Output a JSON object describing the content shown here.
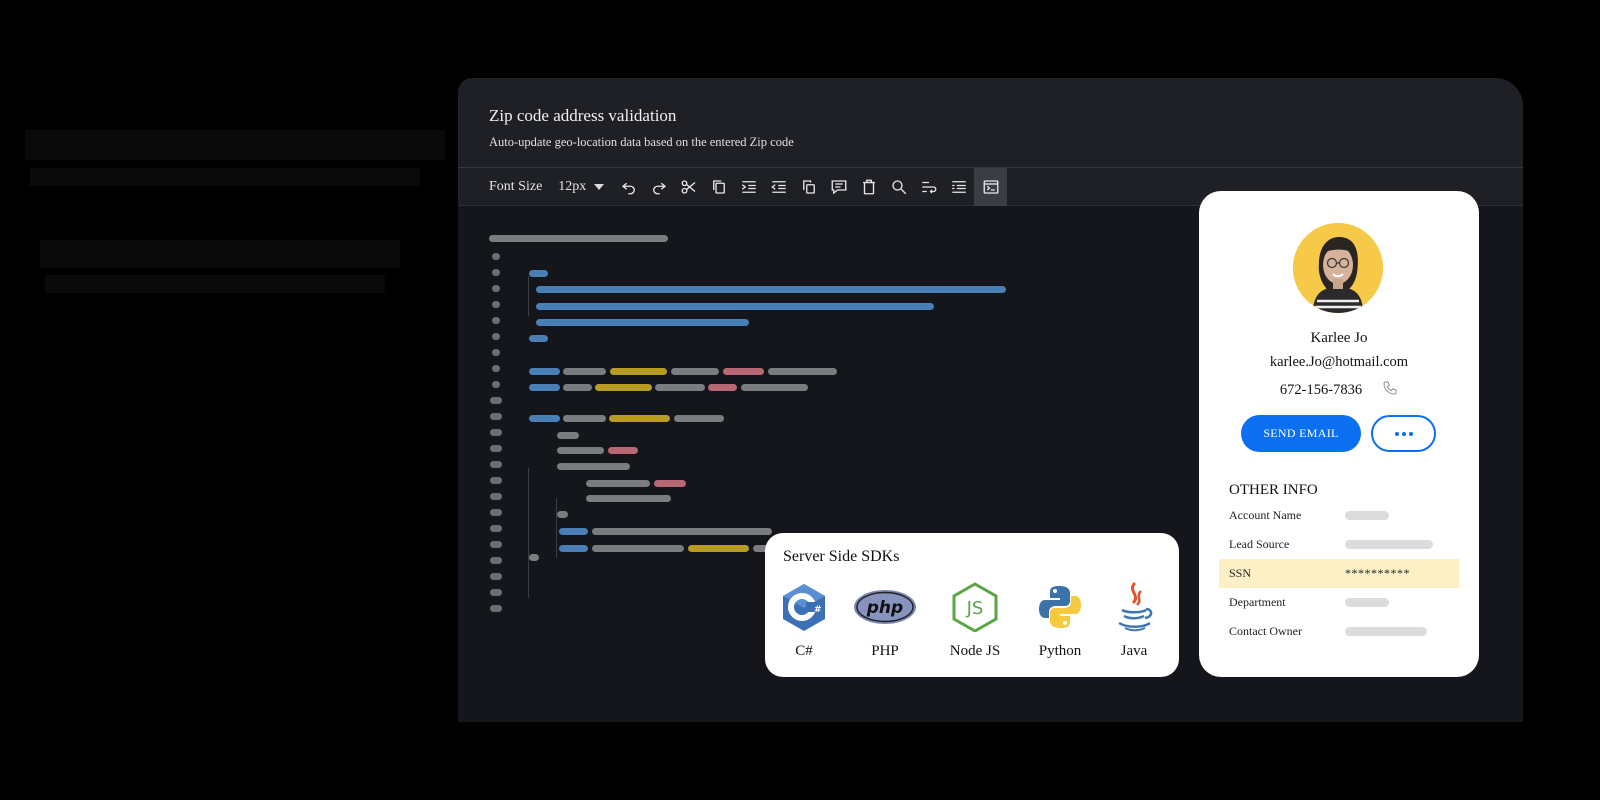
{
  "editor": {
    "title": "Zip code address validation",
    "subtitle": "Auto-update geo-location data based on the entered Zip code",
    "toolbar": {
      "font_size_label": "Font Size",
      "font_size_value": "12px",
      "buttons": [
        "undo-icon",
        "redo-icon",
        "cut-icon",
        "copy-icon",
        "indent-icon",
        "outdent-icon",
        "paste-icon",
        "comment-icon",
        "delete-icon",
        "search-icon",
        "word-wrap-icon",
        "format-icon",
        "terminal-icon"
      ]
    }
  },
  "contact": {
    "name": "Karlee Jo",
    "email": "karlee.Jo@hotmail.com",
    "phone": "672-156-7836",
    "send_email_label": "SEND EMAIL",
    "other_info_title": "OTHER INFO",
    "fields": [
      {
        "label": "Account Name",
        "value": ""
      },
      {
        "label": "Lead Source",
        "value": ""
      },
      {
        "label": "SSN",
        "value": "**********"
      },
      {
        "label": "Department",
        "value": ""
      },
      {
        "label": "Contact Owner",
        "value": ""
      }
    ]
  },
  "sdks": {
    "title": "Server Side SDKs",
    "items": [
      {
        "name": "C#",
        "icon": "csharp-icon"
      },
      {
        "name": "PHP",
        "icon": "php-icon"
      },
      {
        "name": "Node JS",
        "icon": "nodejs-icon"
      },
      {
        "name": "Python",
        "icon": "python-icon"
      },
      {
        "name": "Java",
        "icon": "java-icon"
      }
    ]
  },
  "colors": {
    "accent": "#0b6ff0",
    "editor_bg": "#14161b",
    "highlight": "#fdf0c4"
  }
}
